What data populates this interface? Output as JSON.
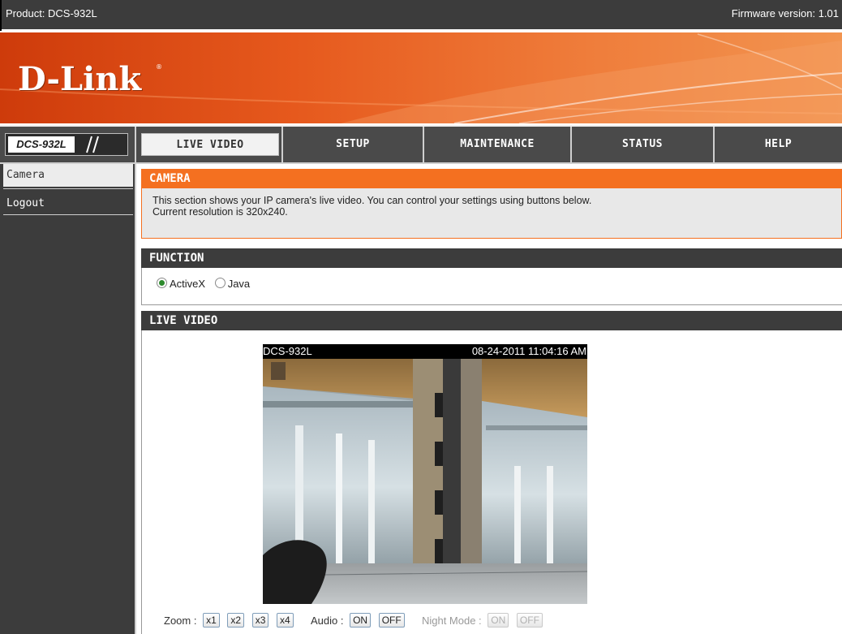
{
  "topbar": {
    "product": "Product: DCS-932L",
    "firmware": "Firmware version: 1.01"
  },
  "banner": {
    "logo": "D-Link",
    "registered_mark": "®"
  },
  "nav": {
    "model": "DCS-932L",
    "tabs": [
      {
        "label": "LIVE VIDEO",
        "active": true
      },
      {
        "label": "SETUP",
        "active": false
      },
      {
        "label": "MAINTENANCE",
        "active": false
      },
      {
        "label": "STATUS",
        "active": false
      },
      {
        "label": "HELP",
        "active": false
      }
    ]
  },
  "sidebar": {
    "items": [
      {
        "label": "Camera",
        "active": true
      },
      {
        "label": "Logout",
        "active": false
      }
    ]
  },
  "camera_section": {
    "title": "CAMERA",
    "description_line1": "This section shows your IP camera's live video. You can control your settings using buttons below.",
    "description_line2": "Current resolution is 320x240."
  },
  "function_section": {
    "title": "FUNCTION",
    "options": [
      {
        "label": "ActiveX",
        "checked": true
      },
      {
        "label": "Java",
        "checked": false
      }
    ]
  },
  "live_video_section": {
    "title": "LIVE VIDEO",
    "overlay_name": "DCS-932L",
    "overlay_timestamp": "08-24-2011 11:04:16 AM"
  },
  "controls": {
    "zoom_label": "Zoom :",
    "zoom_buttons": [
      "x1",
      "x2",
      "x3",
      "x4"
    ],
    "audio_label": "Audio :",
    "audio_buttons": [
      "ON",
      "OFF"
    ],
    "night_label": "Night Mode :",
    "night_buttons": [
      "ON",
      "OFF"
    ],
    "night_enabled": false
  },
  "colors": {
    "accent_orange": "#f47020",
    "dark_bar": "#3c3c3c",
    "banner_start": "#ce3b0b",
    "banner_end": "#f29450"
  }
}
